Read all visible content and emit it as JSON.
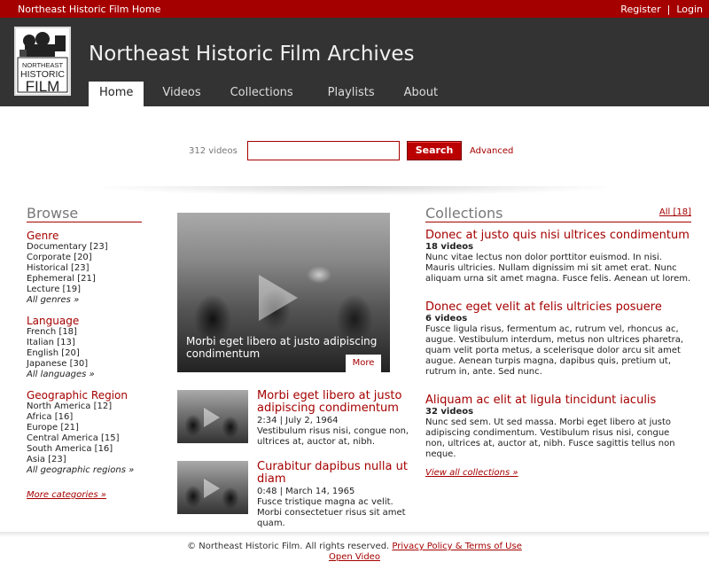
{
  "topbar": {
    "home_link": "Northeast Historic Film Home",
    "register": "Register",
    "separator": "|",
    "login": "Login"
  },
  "header": {
    "logo_text": [
      "NORTHEAST",
      "HISTORIC",
      "FILM"
    ],
    "title": "Northeast Historic Film Archives",
    "nav": [
      "Home",
      "Videos",
      "Collections",
      "Playlists",
      "About"
    ],
    "active_nav": "Home"
  },
  "search": {
    "count": "312 videos",
    "value": "",
    "button": "Search",
    "advanced": "Advanced"
  },
  "browse": {
    "title": "Browse",
    "genre": {
      "heading": "Genre",
      "items": [
        "Documentary [23]",
        "Corporate [20]",
        "Historical [23]",
        "Ephemeral [21]",
        "Lecture [19]"
      ],
      "all": "All genres »"
    },
    "language": {
      "heading": "Language",
      "items": [
        "French [18]",
        "Italian [13]",
        "English [20]",
        "Japanese [30]"
      ],
      "all": "All languages »"
    },
    "region": {
      "heading": "Geographic Region",
      "items": [
        "North America [12]",
        "Africa [16]",
        "Europe [21]",
        "Central America [15]",
        "South America [16]",
        "Asia [23]"
      ],
      "all": "All geographic regions »"
    },
    "more": "More categories »"
  },
  "featured": {
    "caption": "Morbi eget libero at justo adipiscing condimentum",
    "more": "More"
  },
  "videos": [
    {
      "title": "Morbi eget libero at justo adipiscing condimentum",
      "meta": "2:34 | July 2, 1964",
      "desc": "Vestibulum risus nisi, congue non, ultrices at, auctor at, nibh."
    },
    {
      "title": "Curabitur dapibus nulla ut diam",
      "meta": "0:48 | March 14, 1965",
      "desc": "Fusce tristique magna ac velit. Morbi consectetuer risus sit amet quam."
    }
  ],
  "collections": {
    "title": "Collections",
    "all": "All [18]",
    "items": [
      {
        "title": "Donec at justo quis nisi ultrices condimentum",
        "count": "18 videos",
        "desc": "Nunc vitae lectus non dolor porttitor euismod. In nisi. Mauris ultricies. Nullam dignissim mi sit amet erat. Nunc aliquam urna sit amet magna. Fusce felis. Aenean ut lorem."
      },
      {
        "title": "Donec eget velit at felis ultricies posuere",
        "count": "6 videos",
        "desc": "Fusce ligula risus, fermentum ac, rutrum vel, rhoncus ac, augue. Vestibulum interdum, metus non ultrices pharetra, quam velit porta metus, a scelerisque dolor arcu sit amet augue. Aenean turpis magna, dapibus quis, pretium ut, rutrum in, ante. Sed nunc."
      },
      {
        "title": "Aliquam ac elit at ligula tincidunt iaculis",
        "count": "32 videos",
        "desc": "Nunc sed sem. Ut sed massa. Morbi eget libero at justo adipiscing condimentum. Vestibulum risus nisi, congue non, ultrices at, auctor at, nibh. Fusce sagittis tellus non neque."
      }
    ],
    "view_all": "View all collections »"
  },
  "footer": {
    "copyright": "© Northeast Historic Film. All rights reserved.",
    "policy": "Privacy Policy & Terms of Use",
    "open_video": "Open Video"
  },
  "colors": {
    "brand_red": "#a50000",
    "header_dark": "#333333"
  },
  "icons": {
    "play": "play-icon",
    "logo": "film-camera-logo"
  }
}
